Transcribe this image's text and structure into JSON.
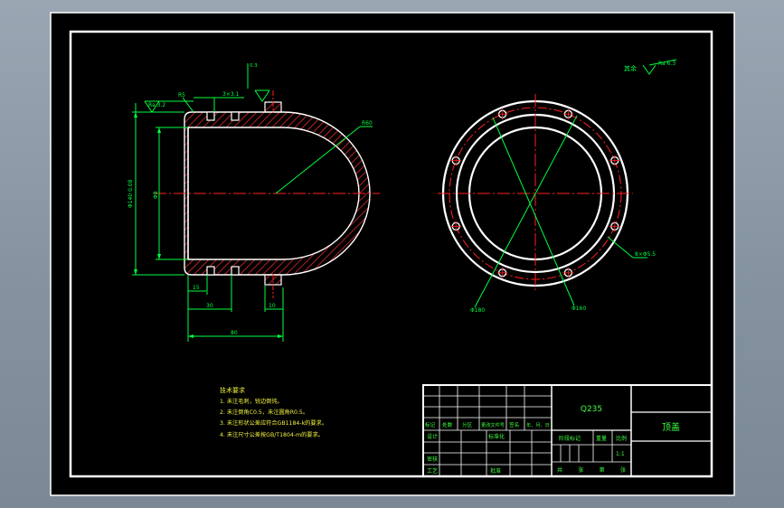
{
  "colors": {
    "background": "#000000",
    "frame": "#ffffff",
    "part_outline": "#ffffff",
    "hatch": "#ff3030",
    "center_line": "#ff2020",
    "dimension": "#00ff40",
    "notes_text": "#f0f040",
    "title_text": "#40ff40"
  },
  "surface_finish": {
    "general": "其余",
    "general_value": "Ra 6.3",
    "left_top": "Ra 3.2",
    "top_stack": "0.3"
  },
  "dimensions": {
    "d_left_outer": "Φ140 0.08",
    "d_left_inner": "Φ8",
    "chamfer_left": "R5",
    "groove_top": "3×3.1",
    "radius_dome": "R60",
    "len_bottom": "80",
    "len_groove": "30",
    "len_step": "15",
    "len_right": "10",
    "hole_label": "8×Φ5.5",
    "pcd_a": "Φ180",
    "pcd_b": "Φ160"
  },
  "notes": {
    "title": "技术要求",
    "items": [
      "1. 未注毛刺，锐边倒钝。",
      "2. 未注倒角C0.5，未注圆角R0.5。",
      "3. 未注形状公差应符合GB1184-k的要求。",
      "4. 未注尺寸公差按GB/T1804-m的要求。"
    ]
  },
  "title_block": {
    "material": "Q235",
    "part_name": "顶盖",
    "sign_row": [
      "标记",
      "处数",
      "分区",
      "更改文件号",
      "签名",
      "年、月、日"
    ],
    "design": "设计",
    "standardize": "标准化",
    "check": "审核",
    "process": "工艺",
    "approve": "批准",
    "stage_mark": "阶段标记",
    "weight": "重量",
    "scale_label": "比例",
    "scale_value": "1:1",
    "sheet_footer": "共 张 第 张"
  }
}
